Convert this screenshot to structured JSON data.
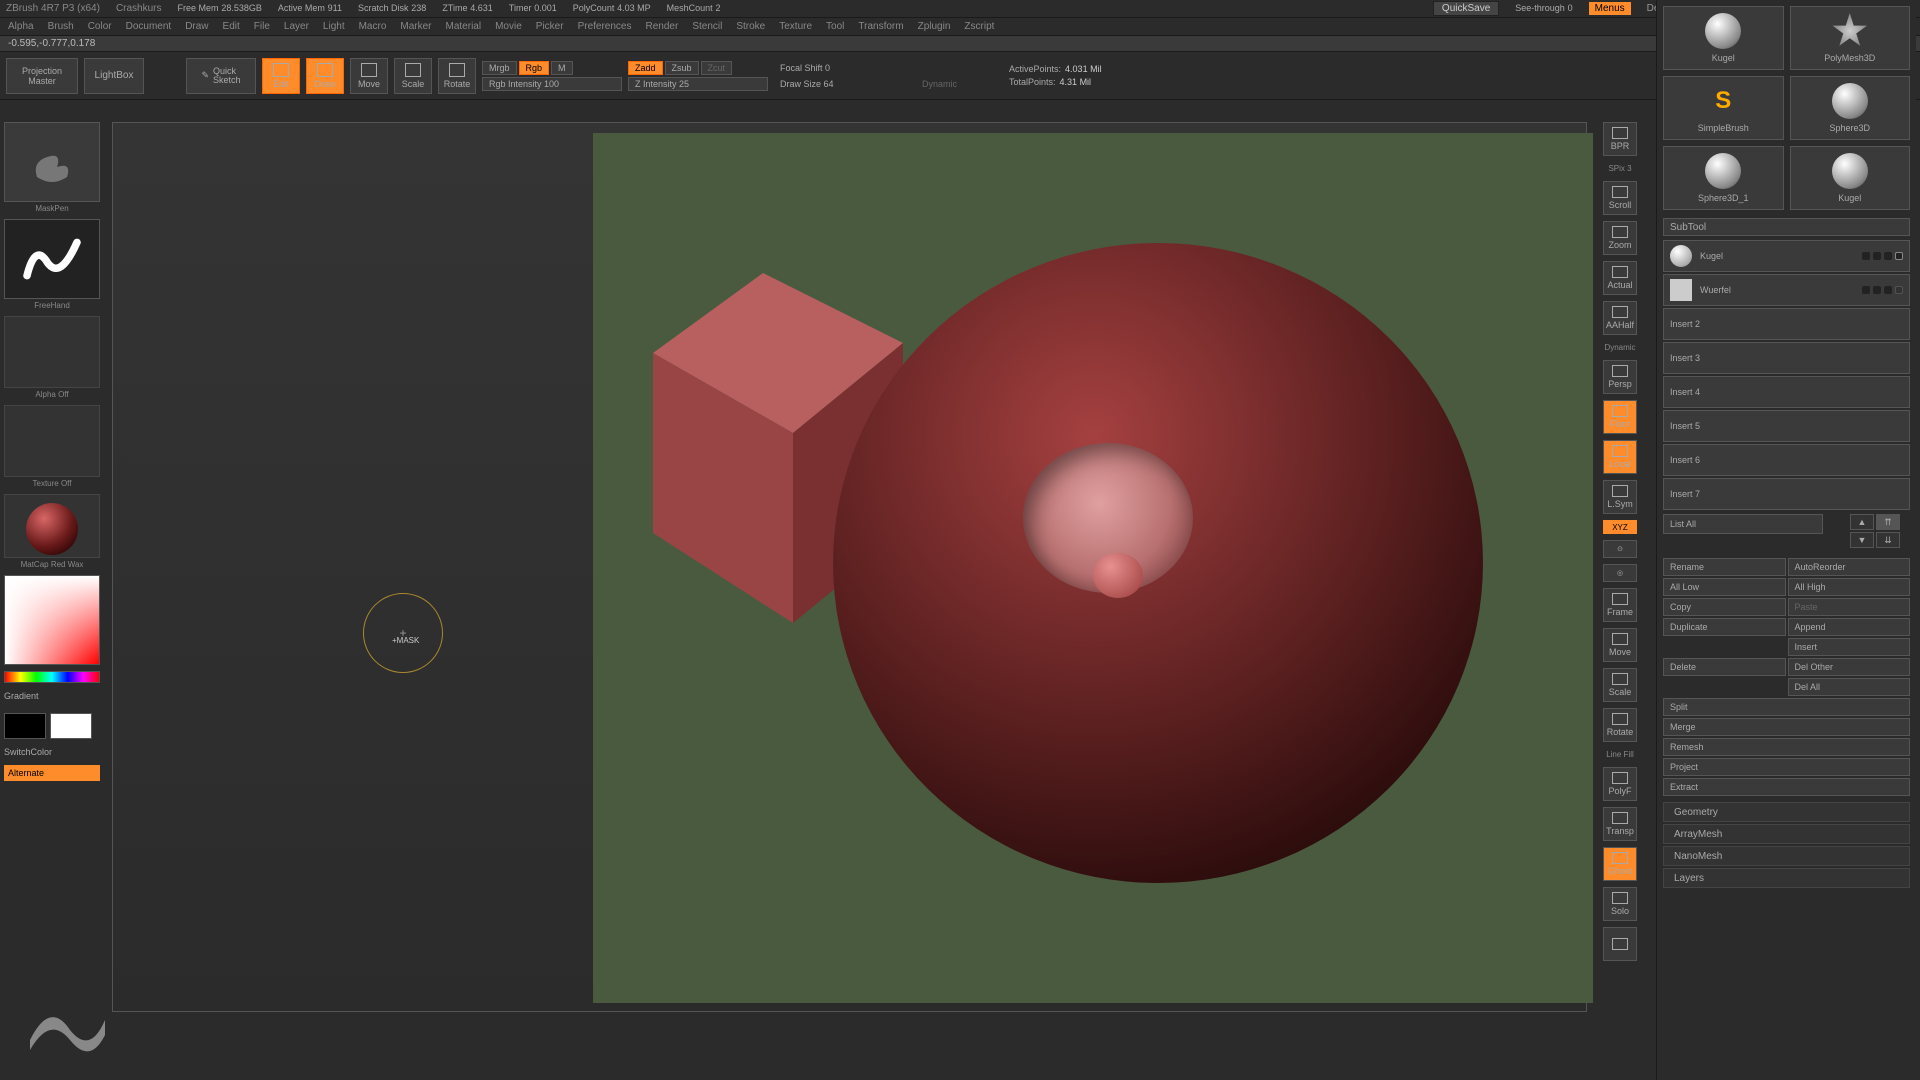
{
  "titlebar": {
    "app": "ZBrush 4R7 P3 (x64)",
    "doc": "Crashkurs",
    "freemem_lbl": "Free Mem",
    "freemem_val": "28.538GB",
    "activemem_lbl": "Active Mem",
    "activemem_val": "911",
    "scratch_lbl": "Scratch Disk",
    "scratch_val": "238",
    "ztime_lbl": "ZTime",
    "ztime_val": "4.631",
    "timer_lbl": "Timer",
    "timer_val": "0.001",
    "poly_lbl": "PolyCount",
    "poly_val": "4.03 MP",
    "mesh_lbl": "MeshCount",
    "mesh_val": "2",
    "quicksave": "QuickSave",
    "seethru": "See-through",
    "seethru_val": "0",
    "menus": "Menus",
    "script": "DefaultZScript"
  },
  "menubar": [
    "Alpha",
    "Brush",
    "Color",
    "Document",
    "Draw",
    "Edit",
    "File",
    "Layer",
    "Light",
    "Macro",
    "Marker",
    "Material",
    "Movie",
    "Picker",
    "Preferences",
    "Render",
    "Stencil",
    "Stroke",
    "Texture",
    "Tool",
    "Transform",
    "Zplugin",
    "Zscript"
  ],
  "statusline": "-0.595,-0.777,0.178",
  "shelf": {
    "proj": "Projection Master",
    "lightbox": "LightBox",
    "qsketch": "Quick Sketch",
    "modes": [
      "Edit",
      "Draw",
      "Move",
      "Scale",
      "Rotate"
    ],
    "mrgb": "Mrgb",
    "rgb": "Rgb",
    "m": "M",
    "rgbint": "Rgb Intensity 100",
    "zadd": "Zadd",
    "zsub": "Zsub",
    "zcut": "Zcut",
    "zint": "Z Intensity 25",
    "focal": "Focal Shift 0",
    "drawsize": "Draw Size 64",
    "dynamic": "Dynamic",
    "active_lbl": "ActivePoints:",
    "active_val": "4.031 Mil",
    "total_lbl": "TotalPoints:",
    "total_val": "4.31 Mil"
  },
  "left": {
    "brush_name": "MaskPen",
    "stroke_name": "FreeHand",
    "alpha": "Alpha Off",
    "texture": "Texture Off",
    "material": "MatCap Red Wax",
    "gradient": "Gradient",
    "switch": "SwitchColor",
    "alternate": "Alternate"
  },
  "cursor_label": "+MASK",
  "rnav": {
    "bpr": "BPR",
    "spix": "SPix 3",
    "scroll": "Scroll",
    "zoom": "Zoom",
    "actual": "Actual",
    "aahalf": "AAHalf",
    "persp": "Persp",
    "floor": "Floor",
    "local": "Local",
    "lsym": "L.Sym",
    "xyz": "XYZ",
    "frame": "Frame",
    "move": "Move",
    "scale": "Scale",
    "rotate": "Rotate",
    "linefill": "Line Fill",
    "polyf": "PolyF",
    "transp": "Transp",
    "ghost": "Ghost",
    "solo": "Solo"
  },
  "tools": {
    "kugel": "Kugel",
    "polymesh": "PolyMesh3D",
    "simplebrush": "SimpleBrush",
    "sphere3d": "Sphere3D",
    "sphere3d1": "Sphere3D_1",
    "kugel2": "Kugel"
  },
  "subtool": {
    "header": "SubTool",
    "items": [
      {
        "name": "Kugel",
        "active": true
      },
      {
        "name": "Wuerfel",
        "active": false
      },
      {
        "name": "Insert 2",
        "dim": true
      },
      {
        "name": "Insert 3",
        "dim": true
      },
      {
        "name": "Insert 4",
        "dim": true
      },
      {
        "name": "Insert 5",
        "dim": true
      },
      {
        "name": "Insert 6",
        "dim": true
      },
      {
        "name": "Insert 7",
        "dim": true
      }
    ],
    "listall": "List All",
    "buttons": {
      "rename": "Rename",
      "autoreorder": "AutoReorder",
      "alllow": "All Low",
      "allhigh": "All High",
      "copy": "Copy",
      "paste": "Paste",
      "duplicate": "Duplicate",
      "append": "Append",
      "insert": "Insert",
      "delete": "Delete",
      "delother": "Del Other",
      "delall": "Del All",
      "split": "Split",
      "merge": "Merge",
      "remesh": "Remesh",
      "project": "Project",
      "extract": "Extract"
    }
  },
  "panels": [
    "Geometry",
    "ArrayMesh",
    "NanoMesh",
    "Layers"
  ]
}
